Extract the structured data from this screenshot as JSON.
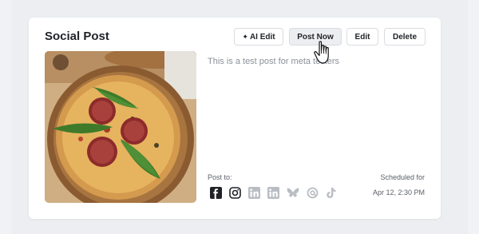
{
  "card": {
    "title": "Social Post",
    "body_text": "This is a test post for meta testers",
    "image": "pizza-photo"
  },
  "actions": {
    "ai_edit_label": "AI Edit",
    "post_now_label": "Post Now",
    "edit_label": "Edit",
    "delete_label": "Delete"
  },
  "post_to": {
    "label": "Post to:",
    "platforms": [
      {
        "name": "facebook-icon",
        "color": "#1f2328",
        "active": true
      },
      {
        "name": "instagram-icon",
        "color": "#1f2328",
        "active": true
      },
      {
        "name": "linkedin-icon",
        "color": "#b9bdc3",
        "active": false
      },
      {
        "name": "linkedin-icon",
        "color": "#b9bdc3",
        "active": false
      },
      {
        "name": "bluesky-icon",
        "color": "#b9bdc3",
        "active": false
      },
      {
        "name": "threads-icon",
        "color": "#b9bdc3",
        "active": false
      },
      {
        "name": "tiktok-icon",
        "color": "#b9bdc3",
        "active": false
      }
    ]
  },
  "schedule": {
    "label": "Scheduled for",
    "date": "Apr 12, 2:30 PM"
  },
  "colors": {
    "page_background": "#eceef1",
    "card_background": "#ffffff",
    "muted_text": "#8b9098",
    "inactive_icon": "#b9bdc3"
  }
}
